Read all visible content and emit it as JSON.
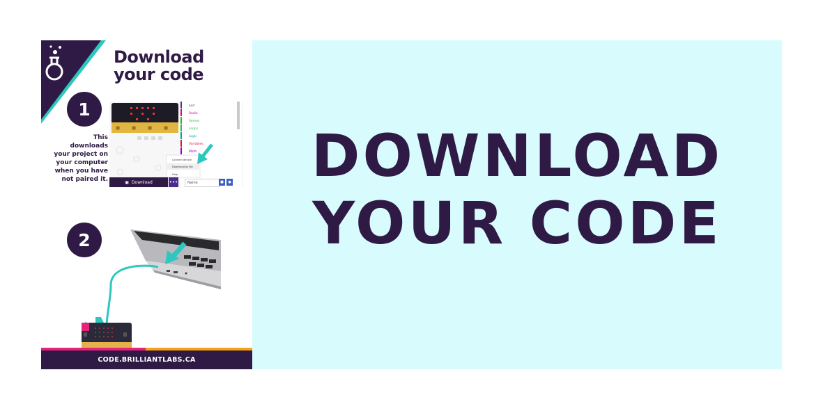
{
  "card": {
    "title_line1": "Download",
    "title_line2": "your code",
    "step1_number": "1",
    "step1_text": "This downloads your project on your computer when you have not paired it.",
    "step2_number": "2",
    "editor": {
      "categories": [
        "Led",
        "Radio",
        "Servos",
        "Loops",
        "Logic",
        "Variables",
        "Math"
      ],
      "menu_items": [
        "Connect device",
        "Download as file",
        "Help"
      ],
      "download_label": "Download",
      "more_label": "•••",
      "name_value": "Name"
    },
    "footer_text": "CODE.BRILLIANTLABS.CA",
    "logo_icon": "flask-icon"
  },
  "panel": {
    "headline_line1": "DOWNLOAD",
    "headline_line2": "YOUR CODE"
  },
  "colors": {
    "brand_purple": "#2f1a45",
    "teal": "#2ec7c0",
    "pink": "#e6227a",
    "orange": "#f6a21a",
    "panel_bg": "#d8fcfd"
  }
}
